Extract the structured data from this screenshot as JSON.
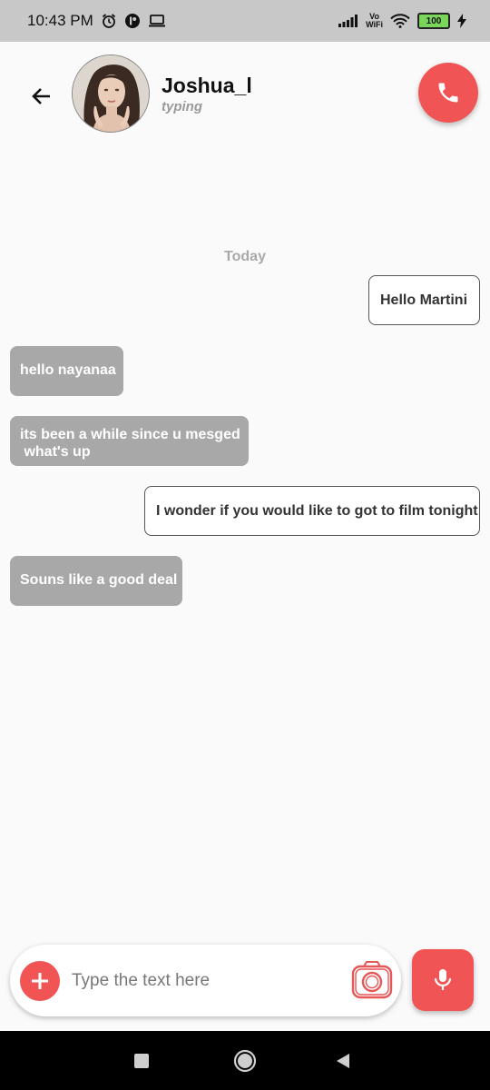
{
  "status_bar": {
    "time": "10:43 PM",
    "wifi_label_top": "Vo",
    "wifi_label_bottom": "WiFi",
    "battery": "100"
  },
  "header": {
    "contact_name": "Joshua_l",
    "contact_status": "typing"
  },
  "chat": {
    "date_label": "Today",
    "messages": [
      {
        "direction": "out",
        "lines": [
          "Hello Martini"
        ]
      },
      {
        "direction": "in",
        "lines": [
          "hello nayanaa"
        ]
      },
      {
        "direction": "in",
        "lines": [
          "its been a while since u mesged",
          " what's up"
        ]
      },
      {
        "direction": "out",
        "lines": [
          "I wonder if you would like to got to film tonight"
        ]
      },
      {
        "direction": "in",
        "lines": [
          "Souns like a good deal"
        ]
      }
    ]
  },
  "composer": {
    "placeholder": "Type the text here",
    "value": ""
  },
  "colors": {
    "accent": "#f05454",
    "incoming_bubble": "#a8a8a8",
    "outgoing_border": "#555555",
    "background": "#fafafa"
  },
  "icons": [
    "alarm-icon",
    "app-badge-icon",
    "laptop-icon",
    "signal-icon",
    "wifi-icon",
    "battery-icon",
    "charging-icon",
    "back-arrow-icon",
    "phone-icon",
    "plus-icon",
    "camera-icon",
    "microphone-icon",
    "recents-icon",
    "home-icon",
    "back-nav-icon"
  ]
}
